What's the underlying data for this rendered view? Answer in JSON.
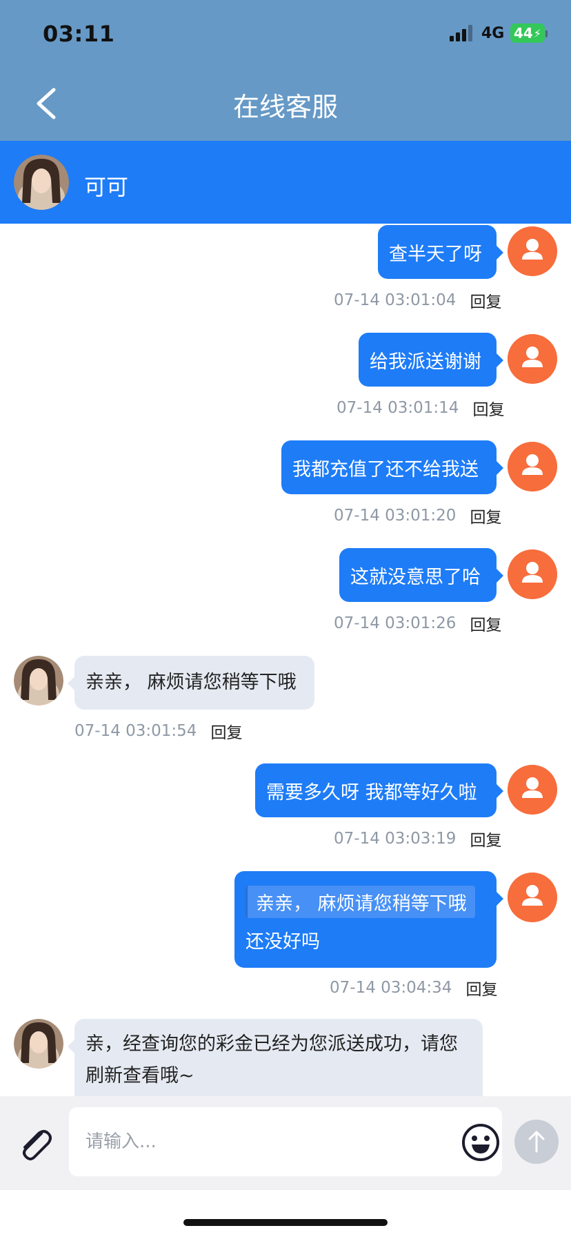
{
  "status_bar": {
    "time": "03:11",
    "network": "4G",
    "battery": "44"
  },
  "header": {
    "title": "在线客服"
  },
  "agent": {
    "name": "可可"
  },
  "messages": [
    {
      "text": "查半天了呀",
      "time": "07-14 03:01:04",
      "reply": "回复"
    },
    {
      "text": "给我派送谢谢",
      "time": "07-14 03:01:14",
      "reply": "回复"
    },
    {
      "text": "我都充值了还不给我送",
      "time": "07-14 03:01:20",
      "reply": "回复"
    },
    {
      "text": "这就没意思了哈",
      "time": "07-14 03:01:26",
      "reply": "回复"
    },
    {
      "text": "亲亲， 麻烦请您稍等下哦",
      "time": "07-14 03:01:54",
      "reply": "回复"
    },
    {
      "text": "需要多久呀 我都等好久啦",
      "time": "07-14 03:03:19",
      "reply": "回复"
    },
    {
      "quote": "亲亲， 麻烦请您稍等下哦",
      "text": "还没好吗",
      "time": "07-14 03:04:34",
      "reply": "回复"
    },
    {
      "text_line1": "亲，经查询您的彩金已经为您派送成功，请您",
      "text_line2": "刷新查看哦~"
    }
  ],
  "input": {
    "placeholder": "请输入..."
  },
  "icons": {
    "back": "chevron-left-icon",
    "attach": "paperclip-icon",
    "emoji": "smiley-icon",
    "send": "arrow-up-icon",
    "user": "user-icon"
  },
  "colors": {
    "header": "#6699c6",
    "agent_bar": "#1e7cf7",
    "bubble_out": "#1e7cf7",
    "bubble_in": "#e5eaf2",
    "user_avatar": "#f76d3c"
  }
}
